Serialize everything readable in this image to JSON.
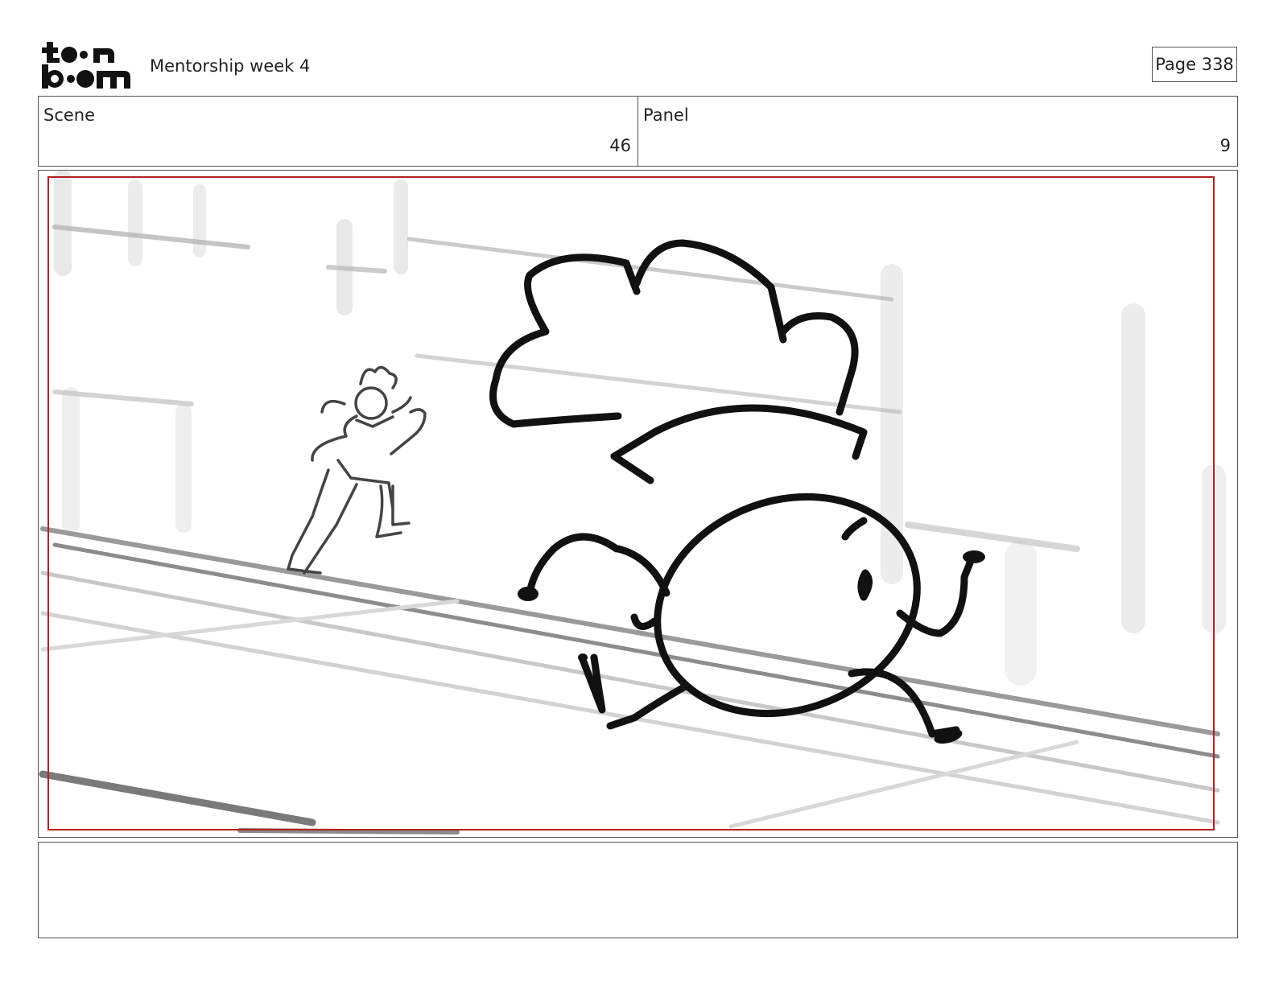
{
  "header": {
    "title": "Mentorship week 4",
    "page_label": "Page 338",
    "logo_word_top": "toon",
    "logo_word_bottom": "boom"
  },
  "info": {
    "scene_label": "Scene",
    "scene_value": "46",
    "panel_label": "Panel",
    "panel_value": "9"
  },
  "colors": {
    "frame_border": "#555555",
    "safe_area": "#b22222",
    "ink": "#111111",
    "sketch_gray": "#888888"
  },
  "notes": {
    "text": ""
  }
}
